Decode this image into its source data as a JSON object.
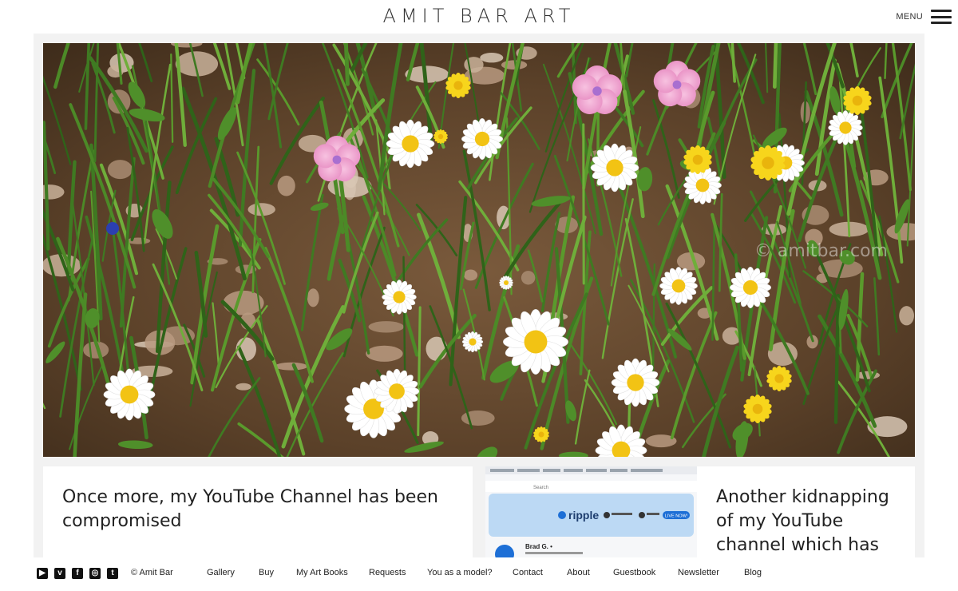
{
  "header": {
    "site_title": "AMIT BAR ART",
    "menu_label": "MENU"
  },
  "hero": {
    "watermark": "© amitbar.com"
  },
  "posts": [
    {
      "title": "Once more, my YouTube Channel has been compromised"
    },
    {
      "title": "Another kidnapping of my YouTube channel which has",
      "thumbnail": {
        "search_placeholder": "Search",
        "brand": "ripple",
        "live_badge": "LIVE NOW!",
        "channel_name": "Brad G. •"
      }
    }
  ],
  "footer": {
    "social": [
      {
        "name": "youtube-icon",
        "glyph": "▶"
      },
      {
        "name": "vimeo-icon",
        "glyph": "v"
      },
      {
        "name": "facebook-icon",
        "glyph": "f"
      },
      {
        "name": "instagram-icon",
        "glyph": "◎"
      },
      {
        "name": "twitter-icon",
        "glyph": "t"
      }
    ],
    "copyright": "© Amit Bar",
    "nav": [
      "Gallery",
      "Buy",
      "My Art Books",
      "Requests",
      "You as a model?",
      "Contact",
      "About",
      "Guestbook",
      "Newsletter",
      "Blog"
    ]
  },
  "colors": {
    "accent_text": "#222222",
    "frame_bg": "#f2f2f2",
    "ripple_blue": "#1d6fd6"
  }
}
